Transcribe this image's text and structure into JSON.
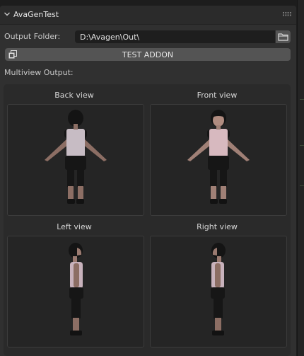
{
  "panel": {
    "title": "AvaGenTest",
    "output_folder_label": "Output Folder:",
    "output_folder_value": "D:\\Avagen\\Out\\",
    "test_button_label": "TEST ADDON",
    "multiview_label": "Multiview Output:"
  },
  "views": [
    {
      "label": "Back view",
      "kind": "back"
    },
    {
      "label": "Front view",
      "kind": "front"
    },
    {
      "label": "Left view",
      "kind": "left"
    },
    {
      "label": "Right view",
      "kind": "right"
    }
  ],
  "icons": {
    "collapse": "chevron-down-icon",
    "grip": "drag-grip-icon",
    "folder": "folder-icon",
    "test": "addon-icon"
  },
  "colors": {
    "panel_bg": "#303030",
    "field_bg": "#1e1e1e",
    "button_bg": "#545454",
    "text": "#e6e6e6"
  }
}
